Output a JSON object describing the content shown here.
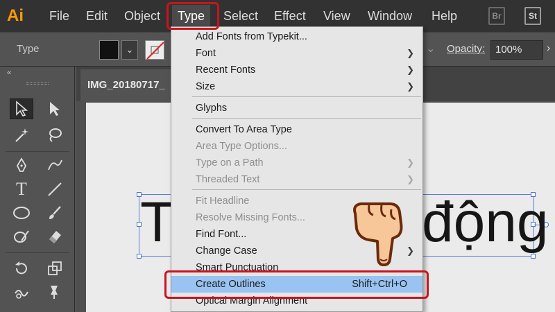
{
  "app": {
    "logo": "Ai"
  },
  "menubar": {
    "items": [
      "File",
      "Edit",
      "Object",
      "Type",
      "Select",
      "Effect",
      "View",
      "Window",
      "Help"
    ],
    "active": "Type",
    "right_icons": [
      "Br",
      "St"
    ]
  },
  "controlbar": {
    "label": "Type",
    "opacity_label": "Opacity:",
    "opacity_value": "100%"
  },
  "document": {
    "tab_title": "IMG_20180717_",
    "text_left": "T",
    "text_right": "động"
  },
  "type_menu": {
    "items": [
      {
        "label": "Add Fonts from Typekit...",
        "disabled": false,
        "submenu": false
      },
      {
        "label": "Font",
        "disabled": false,
        "submenu": true
      },
      {
        "label": "Recent Fonts",
        "disabled": false,
        "submenu": true
      },
      {
        "label": "Size",
        "disabled": false,
        "submenu": true
      },
      {
        "label": "Glyphs",
        "disabled": false,
        "submenu": false
      },
      {
        "label": "Convert To Area Type",
        "disabled": false,
        "submenu": false
      },
      {
        "label": "Area Type Options...",
        "disabled": true,
        "submenu": false
      },
      {
        "label": "Type on a Path",
        "disabled": true,
        "submenu": true
      },
      {
        "label": "Threaded Text",
        "disabled": true,
        "submenu": true
      },
      {
        "label": "Fit Headline",
        "disabled": true,
        "submenu": false
      },
      {
        "label": "Resolve Missing Fonts...",
        "disabled": true,
        "submenu": false
      },
      {
        "label": "Find Font...",
        "disabled": false,
        "submenu": false
      },
      {
        "label": "Change Case",
        "disabled": false,
        "submenu": true
      },
      {
        "label": "Smart Punctuation",
        "disabled": false,
        "submenu": false
      },
      {
        "label": "Create Outlines",
        "disabled": false,
        "submenu": false,
        "shortcut": "Shift+Ctrl+O",
        "highlighted": true
      },
      {
        "label": "Optical Margin Alignment",
        "disabled": false,
        "submenu": false
      }
    ]
  },
  "colors": {
    "highlight": "#99c3f0",
    "annotation_red": "#c8141e",
    "logo_orange": "#ff9a00"
  }
}
